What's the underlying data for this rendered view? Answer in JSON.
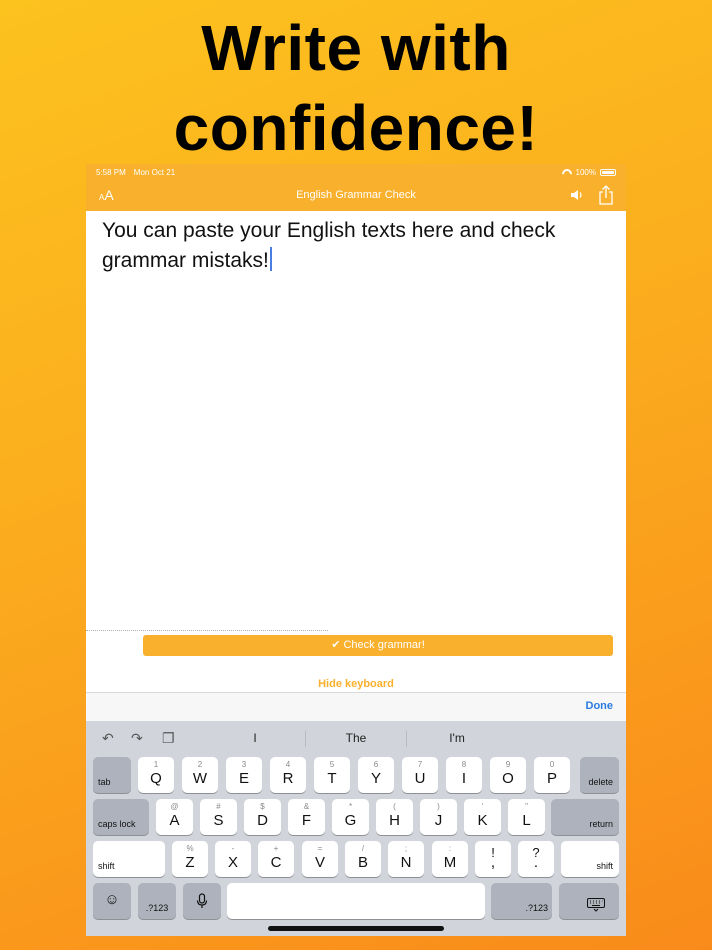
{
  "headline": {
    "line1": "Write with",
    "line2": "confidence!"
  },
  "status_bar": {
    "time": "5:58 PM",
    "date": "Mon Oct 21",
    "battery": "100%"
  },
  "nav": {
    "title": "English Grammar Check",
    "font_icon_small": "A",
    "font_icon_large": "A"
  },
  "editor": {
    "text": "You can paste your English texts here and check grammar mistaks!"
  },
  "check_button": {
    "icon": "checkmark-icon",
    "label": "✔ Check grammar!"
  },
  "hide_keyboard": "Hide keyboard",
  "accessory": {
    "done": "Done"
  },
  "suggestions": [
    "I",
    "The",
    "I'm"
  ],
  "keyboard": {
    "row1_left": "tab",
    "row1": [
      {
        "main": "Q",
        "alt": "1"
      },
      {
        "main": "W",
        "alt": "2"
      },
      {
        "main": "E",
        "alt": "3"
      },
      {
        "main": "R",
        "alt": "4"
      },
      {
        "main": "T",
        "alt": "5"
      },
      {
        "main": "Y",
        "alt": "6"
      },
      {
        "main": "U",
        "alt": "7"
      },
      {
        "main": "I",
        "alt": "8"
      },
      {
        "main": "O",
        "alt": "9"
      },
      {
        "main": "P",
        "alt": "0"
      }
    ],
    "row1_right": "delete",
    "row2_left": "caps lock",
    "row2": [
      {
        "main": "A",
        "alt": "@"
      },
      {
        "main": "S",
        "alt": "#"
      },
      {
        "main": "D",
        "alt": "$"
      },
      {
        "main": "F",
        "alt": "&"
      },
      {
        "main": "G",
        "alt": "*"
      },
      {
        "main": "H",
        "alt": "("
      },
      {
        "main": "J",
        "alt": ")"
      },
      {
        "main": "K",
        "alt": "'"
      },
      {
        "main": "L",
        "alt": "\""
      }
    ],
    "row2_right": "return",
    "row3_left": "shift",
    "row3": [
      {
        "main": "Z",
        "alt": "%"
      },
      {
        "main": "X",
        "alt": "-"
      },
      {
        "main": "C",
        "alt": "+"
      },
      {
        "main": "V",
        "alt": "="
      },
      {
        "main": "B",
        "alt": "/"
      },
      {
        "main": "N",
        "alt": ";"
      },
      {
        "main": "M",
        "alt": ":"
      },
      {
        "main": ",",
        "alt": "!"
      },
      {
        "main": ".",
        "alt": "?"
      }
    ],
    "row3_right": "shift",
    "numbers_left": ".?123",
    "numbers_right": ".?123"
  },
  "colors": {
    "accent": "#f9b02d",
    "link": "#2a7be0",
    "keyboard_bg": "#d1d4da"
  }
}
